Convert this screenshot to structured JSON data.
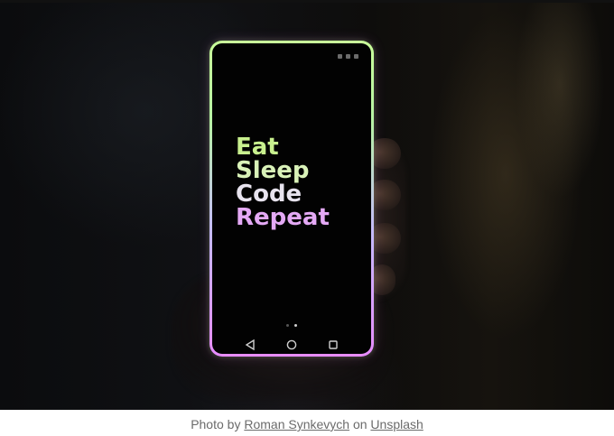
{
  "photo": {
    "phone_screen": {
      "slogan": {
        "line1": "Eat",
        "line2": "Sleep",
        "line3": "Code",
        "line4": "Repeat"
      },
      "nav_icons": [
        "back-triangle-icon",
        "home-circle-icon",
        "recents-square-icon"
      ],
      "colors": {
        "eat": "#c8f08e",
        "sleep": "#d9f2b8",
        "code": "#e7e3ee",
        "repeat": "#e4a9f5",
        "border_top": "#c9ff9a",
        "border_bottom": "#e88cff"
      }
    }
  },
  "caption": {
    "prefix": "Photo by",
    "author": "Roman Synkevych",
    "middle": "on",
    "source": "Unsplash"
  }
}
